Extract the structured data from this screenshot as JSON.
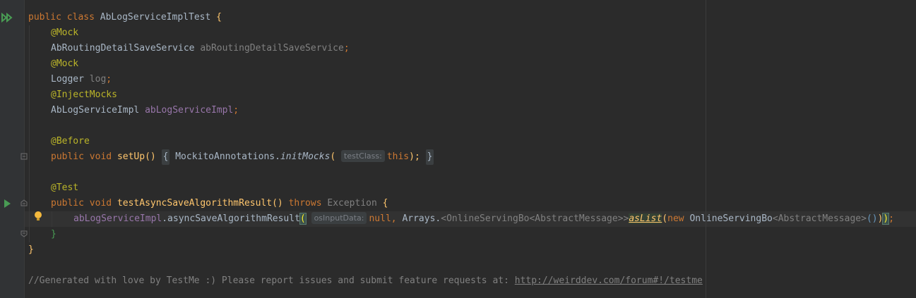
{
  "editor": {
    "lines": {
      "class_decl": {
        "kw1": "public",
        "kw2": "class",
        "name": "AbLogServiceImplTest",
        "brace": "{"
      },
      "mock1": "@Mock",
      "field1": {
        "type": "AbRoutingDetailSaveService",
        "name": "abRoutingDetailSaveService",
        "semi": ";"
      },
      "mock2": "@Mock",
      "field2": {
        "type": "Logger",
        "name": "log",
        "semi": ";"
      },
      "inject": "@InjectMocks",
      "field3": {
        "type": "AbLogServiceImpl",
        "name": "abLogServiceImpl",
        "semi": ";"
      },
      "before": "@Before",
      "setup": {
        "kw1": "public",
        "kw2": "void",
        "name": "setUp",
        "parens": "()",
        "fold_open": "{",
        "call_class": "MockitoAnnotations.",
        "call_method": "initMocks",
        "paren_open": "(",
        "hint": "testClass:",
        "arg": "this",
        "paren_close": ");",
        "fold_close": "}"
      },
      "test": "@Test",
      "test_method": {
        "kw1": "public",
        "kw2": "void",
        "name": "testAsyncSaveAlgorithmResult",
        "parens": "()",
        "throws": "throws",
        "exception": "Exception",
        "brace": "{"
      },
      "body": {
        "field": "abLogServiceImpl",
        "call": ".asyncSaveAlgorithmResult",
        "paren_open": "(",
        "hint": "osInputData:",
        "null": "null",
        "comma": ", ",
        "arrays": "Arrays.",
        "generic": "<OnlineServingBo<AbstractMessage>>",
        "aslist": "asList",
        "paren2": "(",
        "new": "new",
        "type": "OnlineServingBo",
        "generic2": "<AbstractMessage>",
        "ctor": "()",
        "close1": ")",
        "close2": ")",
        "semi": ";"
      },
      "close_method": "}",
      "close_class": "}",
      "comment": "//Generated with love by TestMe :) Please report issues and submit feature requests at: ",
      "comment_link": "http://weirddev.com/forum#!/testme"
    }
  },
  "gutter": {
    "icons": [
      "run-class-icon",
      "run-test-icon",
      "fold-icon",
      "intention-bulb-icon"
    ]
  },
  "colors": {
    "background": "#2b2b2b",
    "gutter": "#313335",
    "keyword": "#cc7832",
    "annotation": "#bbb529",
    "field": "#9876aa",
    "method": "#ffc66d",
    "text": "#a9b7c6",
    "comment": "#808080",
    "run_icon": "#499c54"
  }
}
